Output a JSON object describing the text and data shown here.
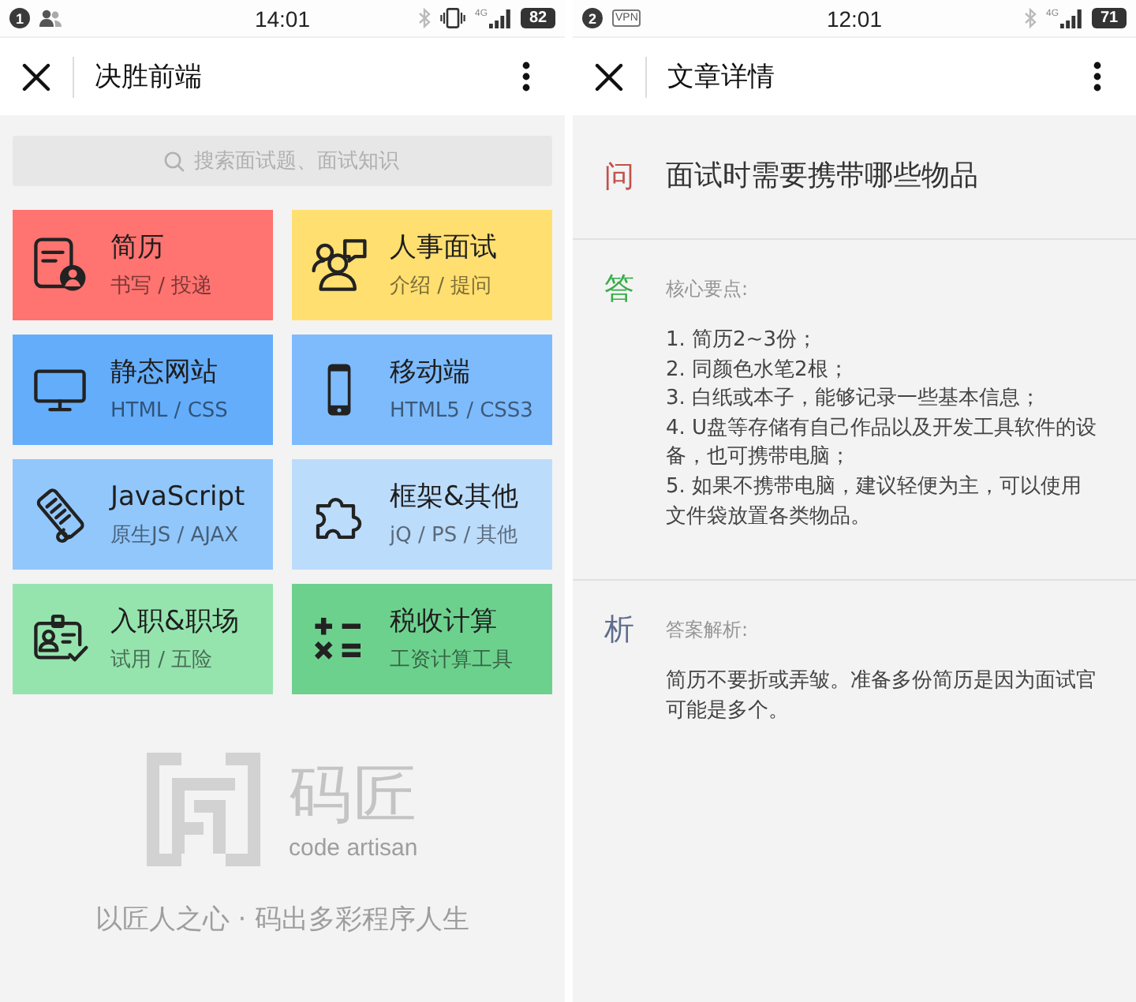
{
  "screens": [
    {
      "kind": "home",
      "status_bar": {
        "leading": [
          {
            "kind": "badge",
            "label": "1"
          },
          {
            "kind": "contacts"
          }
        ],
        "time": "14:01",
        "trailing": [
          {
            "kind": "bluetooth"
          },
          {
            "kind": "vibrate"
          },
          {
            "kind": "signal",
            "label": "4G"
          }
        ],
        "battery": "82"
      },
      "nav": {
        "title": "决胜前端"
      },
      "search": {
        "placeholder": "搜索面试题、面试知识"
      },
      "tiles": [
        {
          "title": "简历",
          "subtitle": "书写 / 投递",
          "color": "#ff7370"
        },
        {
          "title": "人事面试",
          "subtitle": "介绍 / 提问",
          "color": "#ffdf70"
        },
        {
          "title": "静态网站",
          "subtitle": "HTML / CSS",
          "color": "#64adfb"
        },
        {
          "title": "移动端",
          "subtitle": "HTML5 / CSS3",
          "color": "#7dbbfc"
        },
        {
          "title": "JavaScript",
          "subtitle": "原生JS / AJAX",
          "color": "#92c7fb"
        },
        {
          "title": "框架&其他",
          "subtitle": "jQ / PS / 其他",
          "color": "#bcdcfc"
        },
        {
          "title": "入职&职场",
          "subtitle": "试用 / 五险",
          "color": "#95e4ae"
        },
        {
          "title": "税收计算",
          "subtitle": "工资计算工具",
          "color": "#6dd18e"
        }
      ],
      "footer": {
        "brand": "码匠",
        "brand_subtitle": "code artisan",
        "slogan": "以匠人之心 · 码出多彩程序人生"
      }
    },
    {
      "kind": "article",
      "status_bar": {
        "leading": [
          {
            "kind": "badge",
            "label": "2"
          },
          {
            "kind": "vpn",
            "label": "VPN"
          }
        ],
        "time": "12:01",
        "trailing": [
          {
            "kind": "bluetooth"
          },
          {
            "kind": "signal",
            "label": "4G"
          }
        ],
        "battery": "71"
      },
      "nav": {
        "title": "文章详情"
      },
      "question": {
        "label": "问",
        "text": "面试时需要携带哪些物品"
      },
      "answer": {
        "label": "答",
        "heading": "核心要点:",
        "points": [
          "1. 简历2~3份；",
          "2. 同颜色水笔2根；",
          "3. 白纸或本子，能够记录一些基本信息；",
          "4. U盘等存储有自己作品以及开发工具软件的设备，也可携带电脑；",
          "5. 如果不携带电脑，建议轻便为主，可以使用文件袋放置各类物品。"
        ]
      },
      "analysis": {
        "label": "析",
        "heading": "答案解析:",
        "text": "简历不要折或弄皱。准备多份简历是因为面试官可能是多个。"
      }
    }
  ]
}
